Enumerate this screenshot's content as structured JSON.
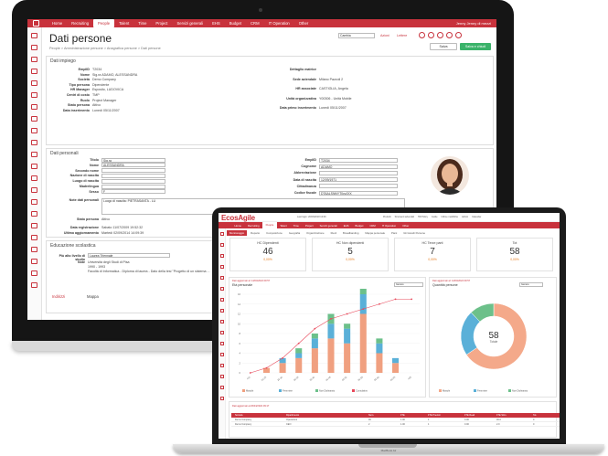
{
  "imac": {
    "nav": [
      "Home",
      "Recruiting",
      "People",
      "Talent",
      "Time",
      "Project",
      "Servizi generali",
      "EHS",
      "Budget",
      "CRM",
      "IT Operation",
      "Other"
    ],
    "nav_active_index": 2,
    "nav_right": "Jenny Jenny di mezzi",
    "title": "Dati persone",
    "breadcrumb": "People > Amministrazione persone > Anagrafica persone > Dati persone",
    "toolbar_select": "Cambia",
    "toolbar_azioni": "Azioni",
    "toolbar_lettere": "Lettere",
    "btn_save": "Salva e chiudi",
    "btn_cancel": "Salva",
    "impiego": {
      "header": "Dati impiego",
      "left": [
        {
          "label": "EmplID",
          "value": "T2034"
        },
        {
          "label": "Nome",
          "value": "Sig.ra ADAMO, ALESSANDRA"
        },
        {
          "label": "Società",
          "value": "Demo Company"
        },
        {
          "label": "Tipo persona",
          "value": "Dipendente"
        },
        {
          "label": "HR Manager",
          "value": "Esposito, LUDOVICA"
        },
        {
          "label": "Centri di costo",
          "value": "TMP"
        },
        {
          "label": "Ruolo",
          "value": "Project Manager"
        },
        {
          "label": "Stato persona",
          "value": "Attivo"
        },
        {
          "label": "Data inserimento",
          "value": "Lunedì 05/11/2007"
        }
      ],
      "right": [
        {
          "label": "Dettaglio matrice",
          "value": ""
        },
        {
          "label": "Sede aziendale",
          "value": "Milano Pazzoli 2"
        },
        {
          "label": "HR associate",
          "value": "CASTIGLIA, Angela"
        },
        {
          "label": "Unità organizzativa",
          "value": "Y00306 - Unità Mobile"
        },
        {
          "label": "Data primo inserimento",
          "value": "Lunedì 05/11/2007"
        }
      ]
    },
    "personali": {
      "header": "Dati personali",
      "left": [
        {
          "label": "Titolo",
          "value": "Sig.ra"
        },
        {
          "label": "Nome",
          "value": "ALESSANDRA"
        },
        {
          "label": "Secondo nome",
          "value": ""
        },
        {
          "label": "Nazione di nascita",
          "value": ""
        },
        {
          "label": "Luogo di nascita",
          "value": ""
        },
        {
          "label": "Madrelingua",
          "value": ""
        },
        {
          "label": "Sesso",
          "value": "F"
        },
        {
          "label": "Note dati personali",
          "value": "Luogo di nascita: PIETRASANTA - LU"
        }
      ],
      "right": [
        {
          "label": "EmplID",
          "value": "T2034"
        },
        {
          "label": "Cognome",
          "value": "ADAMO"
        },
        {
          "label": "Abbreviazione",
          "value": ""
        },
        {
          "label": "Data di nascita",
          "value": "12/09/1971"
        },
        {
          "label": "Cittadinanza",
          "value": ""
        },
        {
          "label": "Codice fiscale",
          "value": "DTAALSNNYT0yyJXX"
        }
      ],
      "stato_label": "Stato persona",
      "stato_value": "Attivo",
      "cancellato": "Cancellamento foto",
      "reg_label": "Data registrazione",
      "reg_value": "Sabato 11/07/2009 19:52:32",
      "upd_label": "Ultimo aggiornamento",
      "upd_value": "Martedì 02/09/2014 14:09:39"
    },
    "istruzione": {
      "header": "Educazione scolastica",
      "row_label": "Più alto livello di studio",
      "row_value": "Laurea Triennale",
      "note_label": "Note",
      "note_value_1": "Università degli Studi di Pisa",
      "note_value_2": "1990 - 1993",
      "note_value_3": "Facoltà di Informatica - Diploma di laurea - Dato della tesi \"Progetto di un sistema ..."
    },
    "bottom_tabs": [
      "Indirizzi",
      "Mappa"
    ]
  },
  "laptop": {
    "logo": "EcosAgile",
    "last_login": "Last login: 20/03/2018 10:09",
    "top_links": [
      "Preferiti",
      "Strumenti aziendali",
      "HR Policy",
      "Guide",
      "Ultime modifiche",
      "Admin",
      "Calendar"
    ],
    "nav": [
      "Home",
      "Recruiting",
      "People",
      "Talent",
      "Time",
      "Project",
      "Servizi generali",
      "EHS",
      "Budget",
      "CRM",
      "IT Operation",
      "Other"
    ],
    "nav_active_index": 2,
    "tabs": [
      "Monitoraggio",
      "Reparto",
      "Composizione",
      "Geografia",
      "Organizzazione",
      "Ruoli",
      "Broadbanding",
      "Mappa personale",
      "Piani",
      "Gli Grandi Persone"
    ],
    "kpis": [
      {
        "label": "HC Dipendenti",
        "value": "46",
        "pct": "0,00%"
      },
      {
        "label": "HC Non dipendenti",
        "value": "5",
        "pct": "0,00%"
      },
      {
        "label": "HC Terze parti",
        "value": "7",
        "pct": "0,00%"
      },
      {
        "label": "Tot",
        "value": "58",
        "pct": "0,00%"
      }
    ],
    "left_panel": {
      "title": "Età personale",
      "sub": "Dati aggiornati al: 14/04/2022 09:57",
      "filter": "Genere"
    },
    "right_panel": {
      "title": "Quantità persone",
      "sub": "Dati aggiornati al: 14/04/2022 09:57",
      "filter": "Genere"
    },
    "table_title": "Dati aggiornati al 26/04/2022 09:17",
    "table_headers": [
      "Società",
      "Dipartimento",
      "Num.",
      "FTE",
      "FTE Previsti",
      "FTE Reali",
      "FTE Stim.",
      "Tot."
    ],
    "table_rows": [
      [
        "Demo Company",
        "Operazioni",
        "46",
        "1.00",
        "1",
        "0.00",
        "46.0",
        "0"
      ],
      [
        "Demo Company",
        "CEO",
        "2",
        "1.00",
        "1",
        "0.00",
        "2.0",
        "0"
      ]
    ],
    "model": "MacBook Air"
  },
  "chart_data": [
    {
      "type": "bar",
      "title": "Età personale",
      "categories": [
        "<20",
        "20-25",
        "25-30",
        "30-35",
        "35-40",
        "40-45",
        "45-50",
        "50-55",
        "55-60",
        "60-65",
        ">65"
      ],
      "ylim": [
        0,
        16
      ],
      "y_ticks": [
        0,
        2,
        4,
        6,
        8,
        10,
        12,
        14,
        16
      ],
      "series": [
        {
          "name": "Maschi",
          "color": "#f0a080",
          "values": [
            0,
            1,
            2,
            3,
            5,
            7,
            6,
            12,
            4,
            2,
            0
          ]
        },
        {
          "name": "Femmine",
          "color": "#5ab0d8",
          "values": [
            0,
            0,
            1,
            1,
            2,
            3,
            3,
            4,
            2,
            1,
            0
          ]
        },
        {
          "name": "Non Dichiarato",
          "color": "#6cc08a",
          "values": [
            0,
            0,
            0,
            1,
            1,
            2,
            1,
            2,
            1,
            0,
            0
          ]
        }
      ],
      "line": {
        "name": "Cumulativo",
        "color": "#e8485a",
        "values": [
          0,
          1,
          3,
          6,
          9,
          11,
          12,
          13,
          14,
          15,
          15
        ]
      },
      "legend": "bottom"
    },
    {
      "type": "pie",
      "title": "Quantità persone",
      "center_value": "58",
      "center_label": "Totale",
      "slices": [
        {
          "name": "Maschi",
          "value": 38,
          "color": "#f4a98a"
        },
        {
          "name": "Femmine",
          "value": 13,
          "color": "#5ab0d8"
        },
        {
          "name": "Non Dichiarato",
          "value": 7,
          "color": "#6cc08a"
        }
      ],
      "legend": "bottom"
    }
  ]
}
